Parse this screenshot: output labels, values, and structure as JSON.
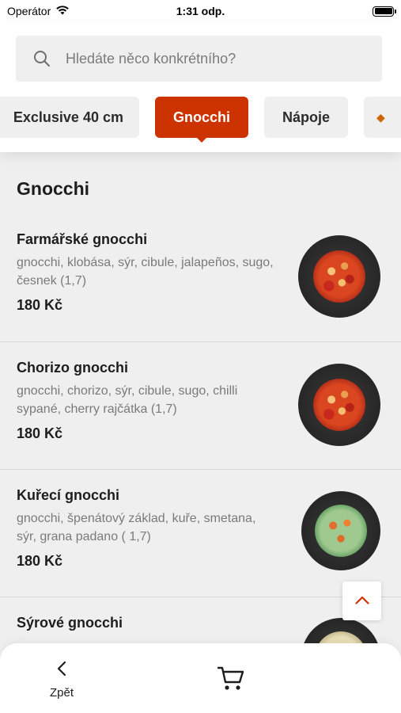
{
  "status_bar": {
    "carrier": "Operátor",
    "time": "1:31 odp."
  },
  "search": {
    "placeholder": "Hledáte něco konkrétního?"
  },
  "categories": [
    {
      "label": "Exclusive 40 cm",
      "selected": false
    },
    {
      "label": "Gnocchi",
      "selected": true
    },
    {
      "label": "Nápoje",
      "selected": false
    },
    {
      "label": "",
      "selected": false
    }
  ],
  "section": {
    "title": "Gnocchi"
  },
  "items": [
    {
      "name": "Farmářské gnocchi",
      "description": "gnocchi, klobása, sýr, cibule, jalapeños, sugo, česnek (1,7)",
      "price": "180 Kč",
      "image": "red-gnocchi-plate"
    },
    {
      "name": "Chorizo gnocchi",
      "description": "gnocchi, chorizo, sýr, cibule, sugo, chilli sypané, cherry rajčátka (1,7)",
      "price": "180 Kč",
      "image": "red-gnocchi-plate"
    },
    {
      "name": "Kuřecí gnocchi",
      "description": "gnocchi, špenátový základ, kuře, smetana, sýr, grana padano ( 1,7)",
      "price": "180 Kč",
      "image": "green-gnocchi-plate"
    },
    {
      "name": "Sýrové gnocchi",
      "description": "",
      "price": "",
      "image": "cheese-gnocchi-plate"
    }
  ],
  "bottom_bar": {
    "back_label": "Zpět"
  },
  "icons": {
    "search": "search-icon",
    "back": "chevron-left-icon",
    "cart": "cart-icon",
    "scroll_top": "chevron-up-icon",
    "wifi": "wifi-icon",
    "battery": "battery-icon"
  },
  "colors": {
    "accent": "#cc3300",
    "background": "#efefef",
    "muted_text": "#7a7a7a"
  }
}
